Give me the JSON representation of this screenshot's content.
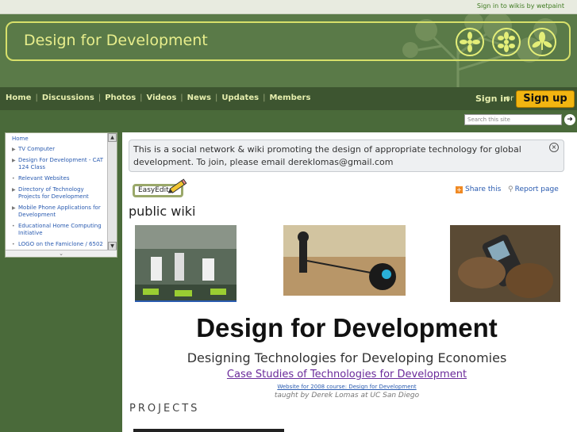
{
  "topbar": {
    "signin_link": "Sign in to wikis by wetpaint"
  },
  "header": {
    "site_title": "Design for Development"
  },
  "nav": {
    "items": [
      "Home",
      "Discussions",
      "Photos",
      "Videos",
      "News",
      "Updates",
      "Members"
    ],
    "signin": "Sign in",
    "or": "or",
    "signup": "Sign up"
  },
  "search": {
    "placeholder": "Search this site",
    "go": "➜"
  },
  "sidebar": {
    "items": [
      {
        "label": "Home",
        "mark": ""
      },
      {
        "label": "TV Computer",
        "mark": "▶"
      },
      {
        "label": "Design For Development - CAT 124 Class",
        "mark": "▶"
      },
      {
        "label": "Relevant Websites",
        "mark": "•"
      },
      {
        "label": "Directory of Technology Projects for Development",
        "mark": "▶"
      },
      {
        "label": "Mobile Phone Applications for Development",
        "mark": "▶"
      },
      {
        "label": "Educational Home Computing Initiative",
        "mark": "•"
      },
      {
        "label": "LOGO on the Famiclone / 6502",
        "mark": "•"
      }
    ],
    "resize_glyph": "⌄"
  },
  "main": {
    "notice": "This is a social network & wiki promoting the design of appropriate technology for global development. To join, please email dereklomas@gmail.com",
    "close": "×",
    "easyedit": "EasyEdit",
    "share": "Share this",
    "share_icon": "+",
    "report": "Report page",
    "report_icon": "⚲",
    "page_title": "public wiki",
    "big_heading": "Design for Development",
    "sub_heading": "Designing Technologies for Developing Economies",
    "case_link": "Case Studies of Technologies for Development",
    "course_link": "Website for 2008 course: Design for Development",
    "taught": "taught by Derek Lomas at UC San Diego",
    "projects": "PROJECTS"
  },
  "colors": {
    "brand_green": "#4a6a3a",
    "accent_yellow": "#f2b511",
    "link_blue": "#2a5bb0"
  }
}
